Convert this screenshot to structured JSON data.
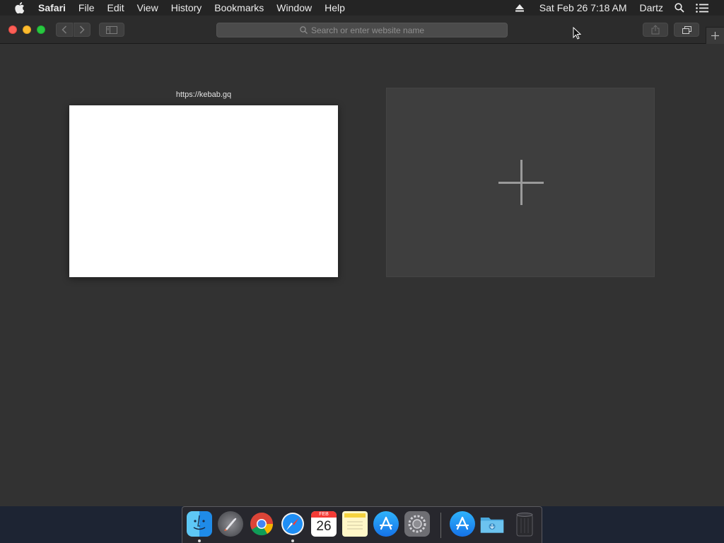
{
  "menubar": {
    "app_name": "Safari",
    "items": [
      "File",
      "Edit",
      "View",
      "History",
      "Bookmarks",
      "Window",
      "Help"
    ],
    "clock": "Sat Feb 26  7:18 AM",
    "user": "Dartz"
  },
  "toolbar": {
    "address_placeholder": "Search or enter website name"
  },
  "top_sites": [
    {
      "label": "https://kebab.gq"
    }
  ],
  "dock": {
    "apps": [
      "finder",
      "launchpad",
      "chrome",
      "safari",
      "calendar",
      "notes",
      "app-store",
      "system-preferences",
      "app-store",
      "downloads",
      "trash"
    ],
    "calendar": {
      "month": "FEB",
      "day": "26"
    }
  },
  "colors": {
    "menubar_bg": "#242424",
    "toolbar_bg": "#2c2c2c",
    "content_bg": "#323232",
    "close": "#fc5f57",
    "minimize": "#fdbc2e",
    "maximize": "#28c840"
  }
}
